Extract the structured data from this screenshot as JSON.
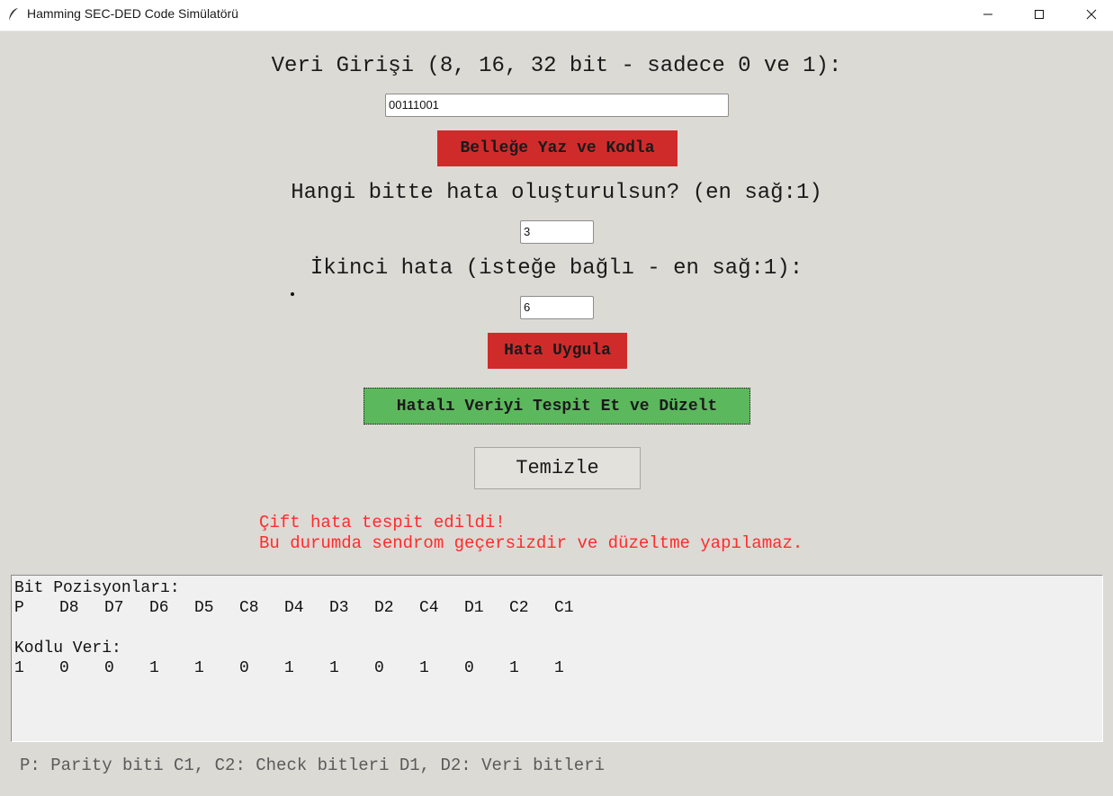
{
  "window": {
    "title": "Hamming SEC-DED Code Simülatörü",
    "icon": "feather-icon"
  },
  "form": {
    "data_label": "Veri Girişi (8, 16, 32 bit - sadece 0 ve 1):",
    "data_value": "00111001",
    "encode_button": "Belleğe Yaz ve Kodla",
    "error_label": "Hangi bitte hata oluşturulsun? (en sağ:1)",
    "error_value": "3",
    "second_error_label": "İkinci hata (isteğe bağlı - en sağ:1):",
    "second_error_value": "6",
    "apply_error_button": "Hata Uygula",
    "detect_button": "Hatalı Veriyi Tespit Et ve Düzelt",
    "clear_button": "Temizle"
  },
  "message": {
    "line1": "Çift hata tespit edildi!",
    "line2": "Bu durumda sendrom geçersizdir ve düzeltme yapılamaz.",
    "color": "#ff2b2b"
  },
  "output": {
    "positions_title": "Bit Pozisyonları:",
    "positions": [
      "P",
      "D8",
      "D7",
      "D6",
      "D5",
      "C8",
      "D4",
      "D3",
      "D2",
      "C4",
      "D1",
      "C2",
      "C1"
    ],
    "encoded_title": "Kodlu Veri:",
    "encoded_bits": [
      "1",
      "0",
      "0",
      "1",
      "1",
      "0",
      "1",
      "1",
      "0",
      "1",
      "0",
      "1",
      "1"
    ]
  },
  "legend": "P: Parity biti  C1, C2: Check bitleri  D1, D2: Veri bitleri",
  "colors": {
    "background": "#dcdad5",
    "red_button": "#d02b2b",
    "green_button": "#5cb85c"
  }
}
